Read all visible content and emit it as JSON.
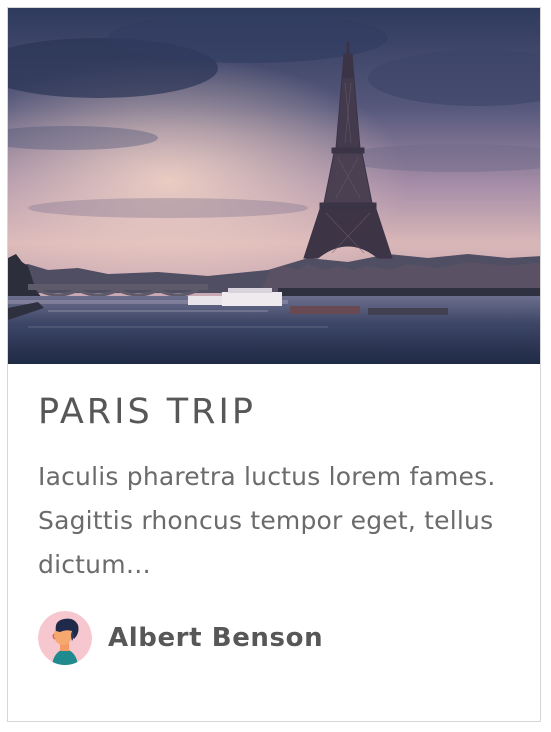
{
  "card": {
    "title": "PARIS TRIP",
    "excerpt": "Iaculis pharetra luctus lorem fames. Sagittis rhoncus tempor eget, tellus dictum…",
    "author": {
      "name": "Albert Benson",
      "avatar_icon": "person-avatar-icon"
    },
    "image_icon": "eiffel-tower-photo"
  },
  "colors": {
    "title": "#575757",
    "text": "#6b6b6b",
    "border": "#d7d7d7",
    "avatar_bg": "#f6c7cf"
  }
}
